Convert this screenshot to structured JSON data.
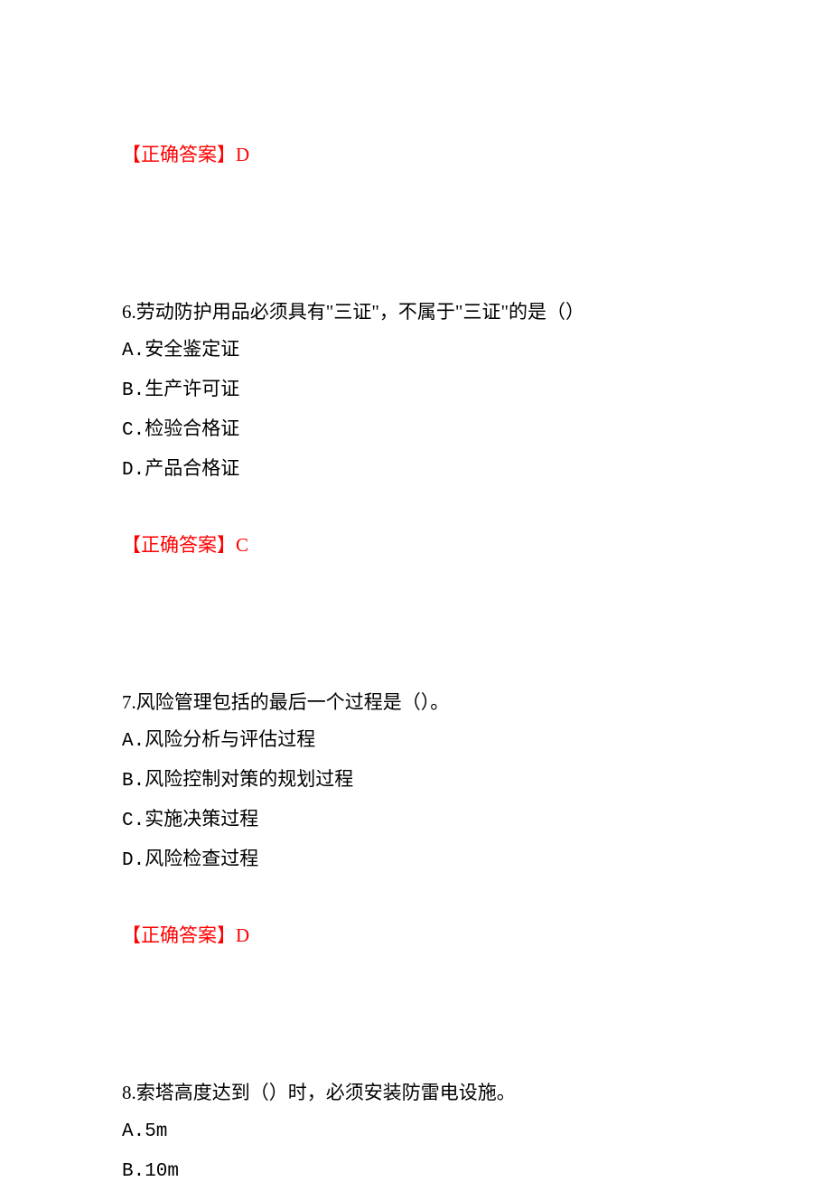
{
  "answer5": {
    "label": "【正确答案】",
    "letter": "D"
  },
  "q6": {
    "text": "6.劳动防护用品必须具有\"三证\"，不属于\"三证\"的是（）",
    "optA": "A.安全鉴定证",
    "optB": "B.生产许可证",
    "optC": "C.检验合格证",
    "optD": "D.产品合格证"
  },
  "answer6": {
    "label": "【正确答案】",
    "letter": "C"
  },
  "q7": {
    "text": "7.风险管理包括的最后一个过程是（）。",
    "optA": "A.风险分析与评估过程",
    "optB": "B.风险控制对策的规划过程",
    "optC": "C.实施决策过程",
    "optD": "D.风险检查过程"
  },
  "answer7": {
    "label": "【正确答案】",
    "letter": "D"
  },
  "q8": {
    "text": "8.索塔高度达到（）时，必须安装防雷电设施。",
    "optA": "A.5m",
    "optB": "B.10m"
  }
}
